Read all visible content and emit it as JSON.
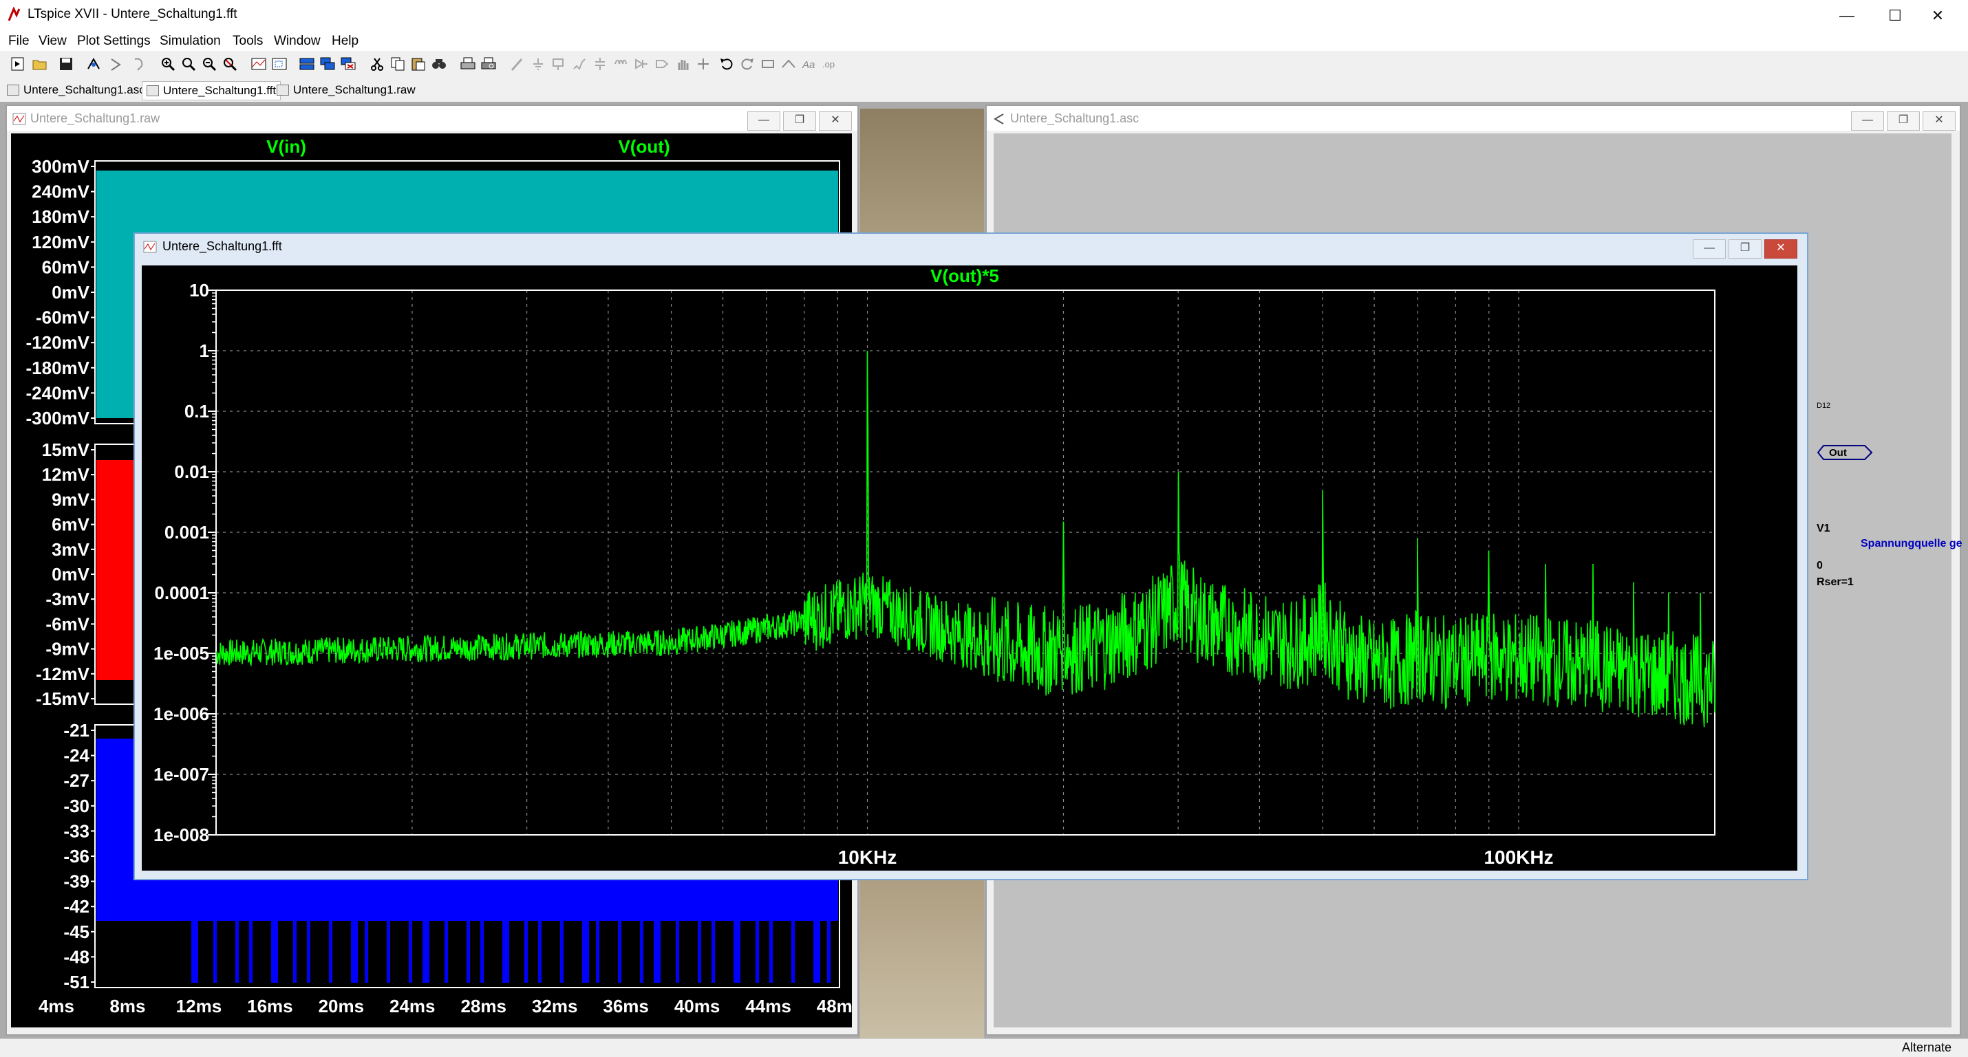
{
  "app": {
    "title": "LTspice XVII - Untere_Schaltung1.fft"
  },
  "window_controls": {
    "minimize": "—",
    "maximize": "☐",
    "close": "✕"
  },
  "menu": [
    "File",
    "View",
    "Plot Settings",
    "Simulation",
    "Tools",
    "Window",
    "Help"
  ],
  "tabs": [
    {
      "label": "Untere_Schaltung1.asc",
      "active": false
    },
    {
      "label": "Untere_Schaltung1.fft",
      "active": true
    },
    {
      "label": "Untere_Schaltung1.raw",
      "active": false
    }
  ],
  "raw_window": {
    "title": "Untere_Schaltung1.raw",
    "traces": [
      "V(in)",
      "V(out)"
    ],
    "pane1_yticks": [
      "300mV",
      "240mV",
      "180mV",
      "120mV",
      "60mV",
      "0mV",
      "-60mV",
      "-120mV",
      "-180mV",
      "-240mV",
      "-300mV"
    ],
    "pane2_yticks": [
      "15mV",
      "12mV",
      "9mV",
      "6mV",
      "3mV",
      "0mV",
      "-3mV",
      "-6mV",
      "-9mV",
      "-12mV",
      "-15mV"
    ],
    "pane3_yticks": [
      "-21",
      "-24",
      "-27",
      "-30",
      "-33",
      "-36",
      "-39",
      "-42",
      "-45",
      "-48",
      "-51"
    ],
    "xticks": [
      "4ms",
      "8ms",
      "12ms",
      "16ms",
      "20ms",
      "24ms",
      "28ms",
      "32ms",
      "36ms",
      "40ms",
      "44ms",
      "48ms"
    ]
  },
  "asc_window": {
    "title": "Untere_Schaltung1.asc",
    "labels": {
      "d12": "D12",
      "out": "Out",
      "v1": "V1",
      "source": "Spannungquelle ge",
      "zero": "0",
      "rser": "Rser=1"
    }
  },
  "fft_window": {
    "title": "Untere_Schaltung1.fft",
    "trace": "V(out)*5",
    "yticks": [
      "10",
      "1",
      "0.1",
      "0.01",
      "0.001",
      "0.0001",
      "1e-005",
      "1e-006",
      "1e-007",
      "1e-008"
    ],
    "xticks": [
      "10KHz",
      "100KHz"
    ]
  },
  "chart_data": {
    "type": "line",
    "title": "V(out)*5",
    "x_scale": "log",
    "y_scale": "log",
    "xlim": [
      1000,
      200000
    ],
    "ylim": [
      1e-08,
      10
    ],
    "grid": true,
    "series": [
      {
        "name": "V(out)*5",
        "color": "#00ff00",
        "peaks": [
          {
            "x": 10000,
            "y": 1
          },
          {
            "x": 20000,
            "y": 0.0015
          },
          {
            "x": 30000,
            "y": 0.01
          },
          {
            "x": 50000,
            "y": 0.005
          },
          {
            "x": 70000,
            "y": 0.0008
          },
          {
            "x": 90000,
            "y": 0.0005
          },
          {
            "x": 110000,
            "y": 0.0003
          },
          {
            "x": 130000,
            "y": 0.0003
          },
          {
            "x": 150000,
            "y": 0.00015
          },
          {
            "x": 170000,
            "y": 0.0001
          },
          {
            "x": 190000,
            "y": 0.0001
          }
        ],
        "noise_floor": [
          {
            "x": 1000,
            "y": 1e-05
          },
          {
            "x": 5000,
            "y": 1.5e-05
          },
          {
            "x": 10000,
            "y": 4e-05
          },
          {
            "x": 20000,
            "y": 8e-06
          },
          {
            "x": 30000,
            "y": 4e-05
          },
          {
            "x": 60000,
            "y": 6e-06
          },
          {
            "x": 100000,
            "y": 8e-06
          },
          {
            "x": 200000,
            "y": 3e-06
          }
        ]
      }
    ]
  },
  "status": {
    "text": "Alternate"
  }
}
